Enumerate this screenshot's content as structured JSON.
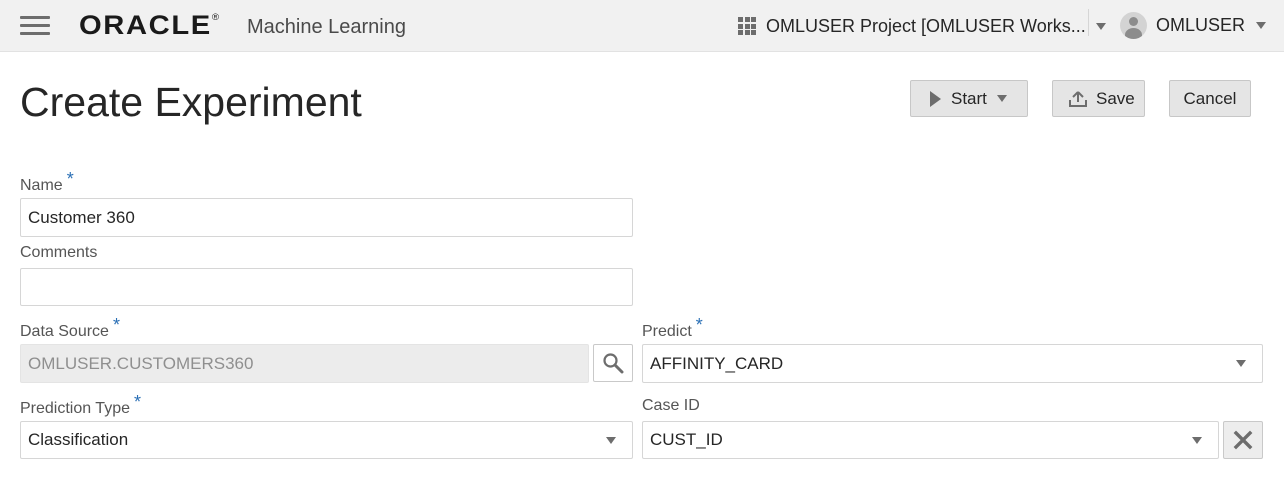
{
  "header": {
    "brand": "ORACLE",
    "brand_mark": "®",
    "app_name": "Machine Learning",
    "project_label": "OMLUSER Project [OMLUSER Works...",
    "user_label": "OMLUSER",
    "icons": {
      "menu": "hamburger-menu-icon",
      "project": "grid-icon",
      "project_caret": "chevron-down-icon",
      "avatar": "user-avatar-icon",
      "user_caret": "chevron-down-icon"
    }
  },
  "page": {
    "title": "Create Experiment"
  },
  "actions": {
    "start_label": "Start",
    "save_label": "Save",
    "cancel_label": "Cancel"
  },
  "form": {
    "required_marker": "*",
    "name": {
      "label": "Name",
      "value": "Customer 360",
      "required": true
    },
    "comments": {
      "label": "Comments",
      "value": "",
      "required": false
    },
    "data_source": {
      "label": "Data Source",
      "value": "OMLUSER.CUSTOMERS360",
      "required": true,
      "disabled": true
    },
    "predict": {
      "label": "Predict",
      "value": "AFFINITY_CARD",
      "required": true
    },
    "prediction_type": {
      "label": "Prediction Type",
      "value": "Classification",
      "required": true
    },
    "case_id": {
      "label": "Case ID",
      "value": "CUST_ID",
      "required": false
    }
  },
  "colors": {
    "header_bg": "#f1f1f1",
    "required_marker": "#2a6fb5",
    "button_bg": "#e5e5e5",
    "disabled_field_bg": "#ececec"
  }
}
